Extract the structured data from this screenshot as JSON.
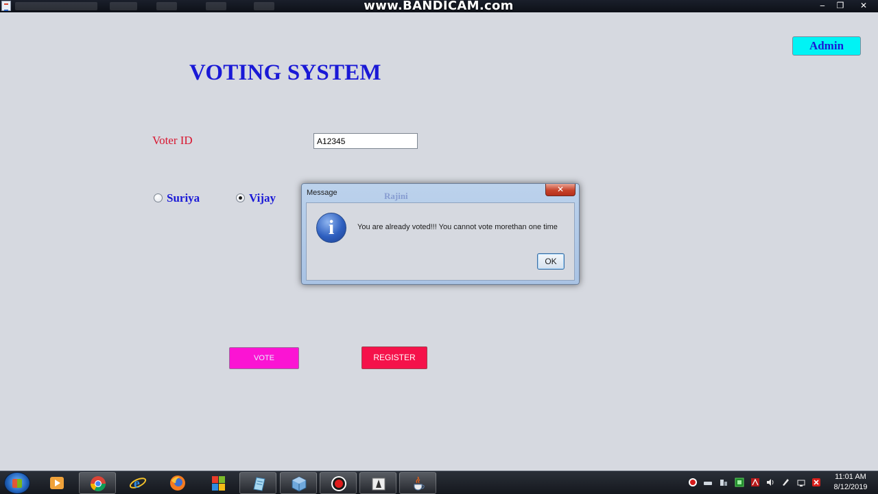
{
  "titlebar": {
    "watermark": "www.BANDICAM.com",
    "minimize": "‒",
    "restore": "❐",
    "close": "✕"
  },
  "form": {
    "title": "VOTING SYSTEM",
    "admin_label": "Admin",
    "voter_id_label": "Voter ID",
    "voter_id_value": "A12345",
    "candidates": [
      {
        "name": "Suriya",
        "selected": false
      },
      {
        "name": "Vijay",
        "selected": true
      },
      {
        "name": "Rajini"
      }
    ],
    "vote_label": "VOTE",
    "register_label": "REGISTER"
  },
  "dialog": {
    "title": "Message",
    "close": "✕",
    "icon_glyph": "i",
    "message": "You are already voted!!! You cannot vote morethan one time",
    "ok_label": "OK"
  },
  "taskbar": {
    "apps": [
      "windows-media-player-icon",
      "chrome-icon",
      "internet-explorer-icon",
      "firefox-icon",
      "office-icon",
      "notepad-icon",
      "virtualbox-icon",
      "bandicam-record-icon",
      "print-icon",
      "java-icon"
    ],
    "clock_time": "11:01 AM",
    "clock_date": "8/12/2019"
  },
  "colors": {
    "title_blue": "#1a19d6",
    "label_red": "#d9152f",
    "admin_cyan": "#00f3f5",
    "vote_magenta": "#fb14d3",
    "register_red": "#f5124a"
  }
}
